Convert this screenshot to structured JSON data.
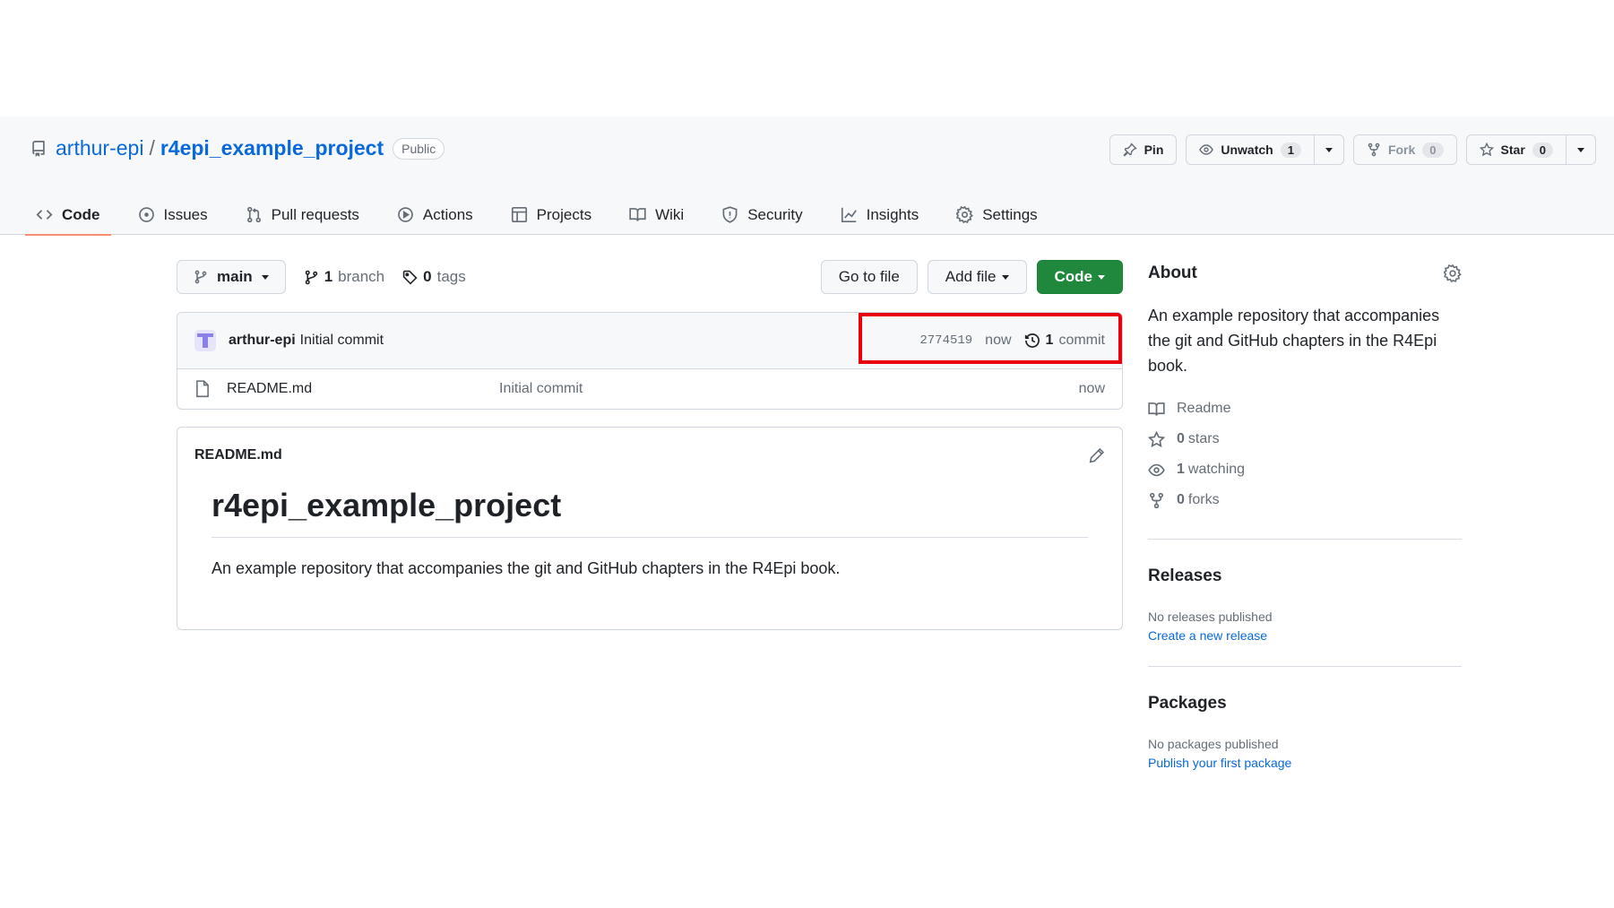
{
  "repo": {
    "owner": "arthur-epi",
    "separator": "/",
    "name": "r4epi_example_project",
    "visibility": "Public"
  },
  "actions": {
    "pin": "Pin",
    "unwatch": "Unwatch",
    "watch_count": "1",
    "fork": "Fork",
    "fork_count": "0",
    "star": "Star",
    "star_count": "0"
  },
  "tabs": [
    {
      "label": "Code",
      "icon": "code-icon",
      "active": true
    },
    {
      "label": "Issues",
      "icon": "issue-icon"
    },
    {
      "label": "Pull requests",
      "icon": "pull-request-icon"
    },
    {
      "label": "Actions",
      "icon": "play-icon"
    },
    {
      "label": "Projects",
      "icon": "table-icon"
    },
    {
      "label": "Wiki",
      "icon": "book-icon"
    },
    {
      "label": "Security",
      "icon": "shield-icon"
    },
    {
      "label": "Insights",
      "icon": "graph-icon"
    },
    {
      "label": "Settings",
      "icon": "gear-icon"
    }
  ],
  "toolbar": {
    "branch": "main",
    "branch_count": "1",
    "branch_label": "branch",
    "tag_count": "0",
    "tag_label": "tags",
    "go_to_file": "Go to file",
    "add_file": "Add file",
    "code": "Code"
  },
  "commit": {
    "author": "arthur-epi",
    "message": "Initial commit",
    "sha": "2774519",
    "time": "now",
    "count": "1",
    "count_label": "commit"
  },
  "files": [
    {
      "name": "README.md",
      "message": "Initial commit",
      "age": "now"
    }
  ],
  "readme": {
    "filename": "README.md",
    "heading": "r4epi_example_project",
    "text": "An example repository that accompanies the git and GitHub chapters in the R4Epi book."
  },
  "about": {
    "title": "About",
    "description": "An example repository that accompanies the git and GitHub chapters in the R4Epi book.",
    "readme": "Readme",
    "stars_count": "0",
    "stars_label": "stars",
    "watching_count": "1",
    "watching_label": "watching",
    "forks_count": "0",
    "forks_label": "forks"
  },
  "releases": {
    "title": "Releases",
    "empty": "No releases published",
    "link": "Create a new release"
  },
  "packages": {
    "title": "Packages",
    "empty": "No packages published",
    "link": "Publish your first package"
  },
  "colors": {
    "accent_link": "#0969da",
    "code_button": "#1f883d",
    "tab_underline": "#fd8c73",
    "highlight_box": "#e8000d"
  }
}
